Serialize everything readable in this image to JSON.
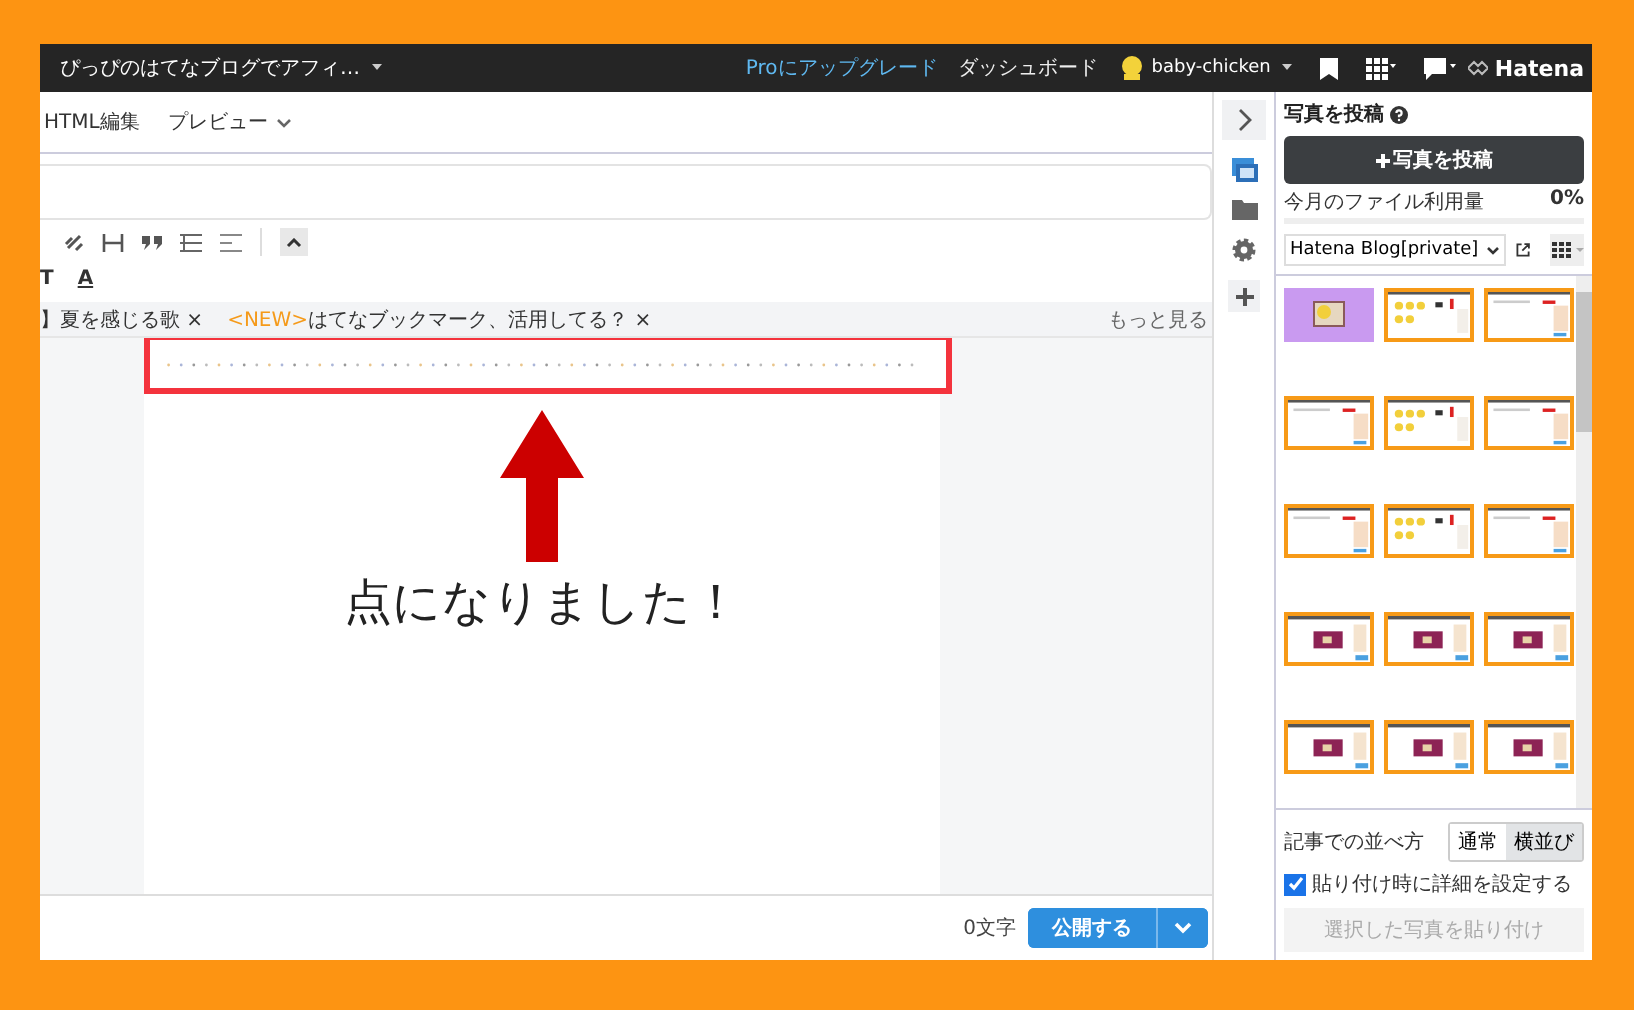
{
  "top_bar": {
    "blog_title": "ぴっぴのはてなブログでアフィ…",
    "upgrade_link": "Proにアップグレード",
    "dashboard_link": "ダッシュボード",
    "user_name": "baby-chicken",
    "brand": "Hatena"
  },
  "editor_tabs": [
    "HTML編集",
    "プレビュー"
  ],
  "format_buttons": [
    "T",
    "A"
  ],
  "topics": [
    {
      "label": "】夏を感じる歌",
      "remove": "×"
    },
    {
      "tag": "<NEW>",
      "label": "はてなブックマーク、活用してる？",
      "remove": "×"
    }
  ],
  "more_link": "もっと見る",
  "annotation": {
    "caption": "点になりました！"
  },
  "footer": {
    "char_count": "0文字",
    "publish_button": "公開する"
  },
  "photo_panel": {
    "title": "写真を投稿",
    "upload_button": "写真を投稿",
    "usage_label": "今月のファイル利用量",
    "usage_value": "0%",
    "level": 0,
    "album": "Hatena Blog[private]",
    "thumbnails": [
      {
        "selected": false
      },
      {
        "selected": true
      },
      {
        "selected": true
      },
      {
        "selected": true
      },
      {
        "selected": true
      },
      {
        "selected": true
      },
      {
        "selected": true
      },
      {
        "selected": true
      },
      {
        "selected": true
      },
      {
        "selected": true
      },
      {
        "selected": true
      },
      {
        "selected": true
      },
      {
        "selected": true
      },
      {
        "selected": true
      },
      {
        "selected": true
      }
    ],
    "layout_label": "記事での並べ方",
    "layout_options": [
      {
        "label": "通常",
        "selected": false
      },
      {
        "label": "横並び",
        "selected": true
      }
    ],
    "detail_checkbox": {
      "label": "貼り付け時に詳細を設定する",
      "checked": true
    },
    "paste_button": {
      "label": "選択した写真を貼り付け",
      "disabled": true
    }
  }
}
